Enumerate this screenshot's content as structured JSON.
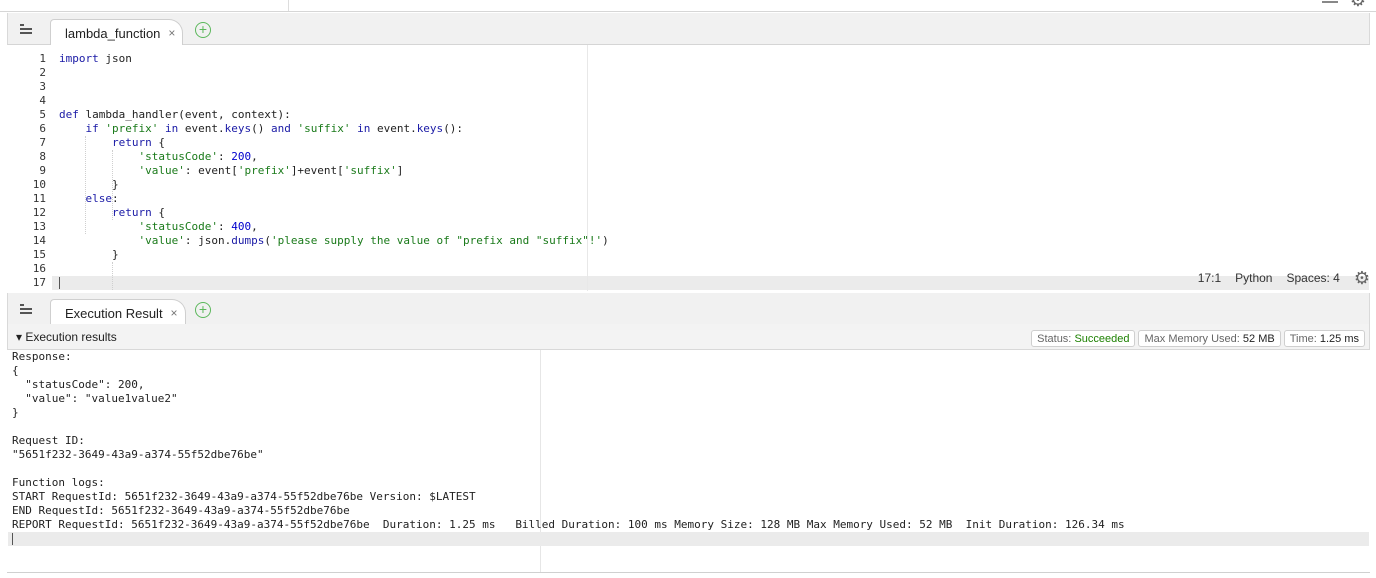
{
  "editor": {
    "tab_label": "lambda_function",
    "close_glyph": "×",
    "add_glyph": "+",
    "line_numbers": [
      "1",
      "2",
      "3",
      "4",
      "5",
      "6",
      "7",
      "8",
      "9",
      "10",
      "11",
      "12",
      "13",
      "14",
      "15",
      "16",
      "17"
    ],
    "status": {
      "cursor_position": "17:1",
      "language": "Python",
      "spaces": "Spaces: 4"
    }
  },
  "results": {
    "tab_label": "Execution Result",
    "close_glyph": "×",
    "add_glyph": "+",
    "section_title": "Execution results",
    "status_label": "Status:",
    "status_value": "Succeeded",
    "memory_label": "Max Memory Used:",
    "memory_value": "52 MB",
    "time_label": "Time:",
    "time_value": "1.25 ms",
    "output_lines": [
      "Response:",
      "{",
      "  \"statusCode\": 200,",
      "  \"value\": \"value1value2\"",
      "}",
      "",
      "Request ID:",
      "\"5651f232-3649-43a9-a374-55f52dbe76be\"",
      "",
      "Function logs:",
      "START RequestId: 5651f232-3649-43a9-a374-55f52dbe76be Version: $LATEST",
      "END RequestId: 5651f232-3649-43a9-a374-55f52dbe76be",
      "REPORT RequestId: 5651f232-3649-43a9-a374-55f52dbe76be  Duration: 1.25 ms   Billed Duration: 100 ms Memory Size: 128 MB Max Memory Used: 52 MB  Init Duration: 126.34 ms"
    ]
  },
  "code": {
    "l1_kw": "import",
    "l1_rest": " json",
    "l5_kw": "def",
    "l5_rest": " lambda_handler(event, context):",
    "l6_kw": "if",
    "l6_s1": "'prefix'",
    "l6_in1": "in",
    "l6_mid": " event.",
    "l6_keys1": "keys",
    "l6_p1": "() ",
    "l6_and": "and",
    "l6_s2": "'suffix'",
    "l6_in2": "in",
    "l6_mid2": " event.",
    "l6_keys2": "keys",
    "l6_end": "():",
    "l7_kw": "return",
    "l7_rest": " {",
    "l8_s": "'statusCode'",
    "l8_colon": ": ",
    "l8_num": "200",
    "l8_end": ",",
    "l9_s": "'value'",
    "l9_mid": ": event[",
    "l9_s2": "'prefix'",
    "l9_mid2": "]+event[",
    "l9_s3": "'suffix'",
    "l9_end": "]",
    "l10": "}",
    "l11_kw": "else",
    "l11_end": ":",
    "l12_kw": "return",
    "l12_rest": " {",
    "l13_s": "'statusCode'",
    "l13_colon": ": ",
    "l13_num": "400",
    "l13_end": ",",
    "l14_s": "'value'",
    "l14_mid": ": json.",
    "l14_fn": "dumps",
    "l14_open": "(",
    "l14_s2": "'please supply the value of \"prefix and \"suffix\"!'",
    "l14_end": ")",
    "l15": "}"
  }
}
